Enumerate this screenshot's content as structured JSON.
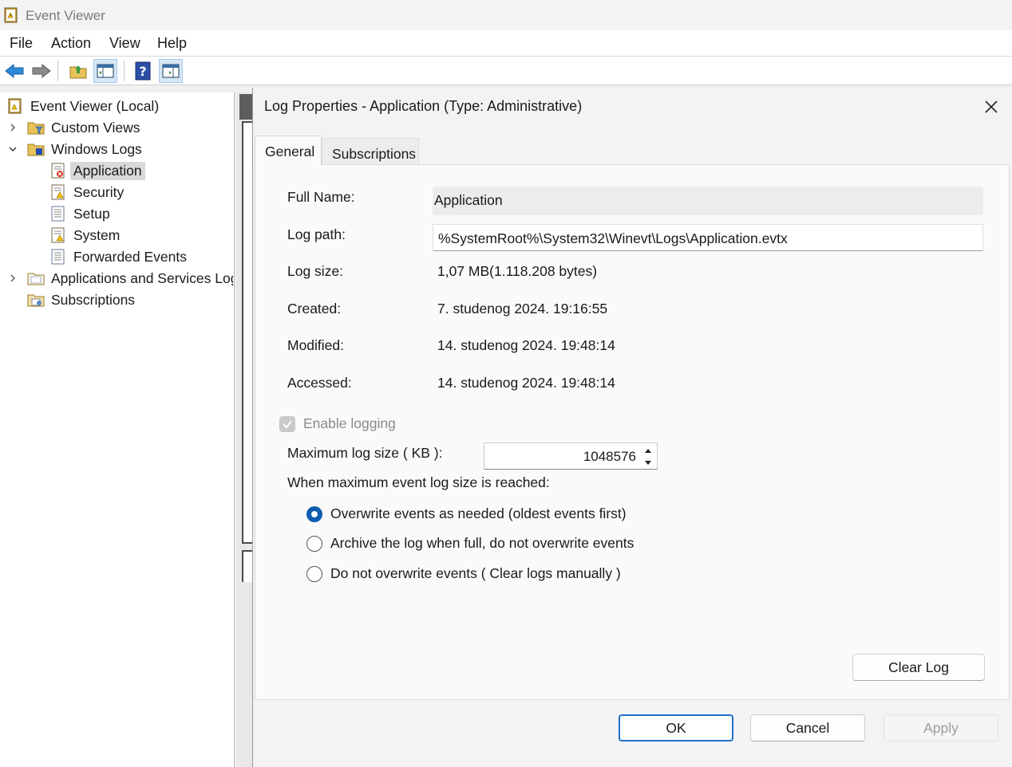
{
  "window": {
    "title": "Event Viewer"
  },
  "menu": {
    "items": [
      "File",
      "Action",
      "View",
      "Help"
    ]
  },
  "toolbar": {
    "icons": [
      "back-arrow-icon",
      "forward-arrow-icon",
      "up-folder-icon",
      "show-hide-tree-icon",
      "help-icon",
      "show-hide-action-pane-icon"
    ]
  },
  "tree": {
    "root": "Event Viewer (Local)",
    "custom_views": "Custom Views",
    "windows_logs": "Windows Logs",
    "application": "Application",
    "security": "Security",
    "setup": "Setup",
    "system": "System",
    "forwarded_events": "Forwarded Events",
    "apps_services": "Applications and Services Logs",
    "subscriptions": "Subscriptions"
  },
  "dialog": {
    "title": "Log Properties - Application (Type: Administrative)",
    "tabs": [
      "General",
      "Subscriptions"
    ],
    "labels": {
      "full_name": "Full Name:",
      "log_path": "Log path:",
      "log_size": "Log size:",
      "created": "Created:",
      "modified": "Modified:",
      "accessed": "Accessed:"
    },
    "values": {
      "full_name": "Application",
      "log_path": "%SystemRoot%\\System32\\Winevt\\Logs\\Application.evtx",
      "log_size": "1,07 MB(1.118.208 bytes)",
      "created": "7. studenog 2024. 19:16:55",
      "modified": "14. studenog 2024. 19:48:14",
      "accessed": "14. studenog 2024. 19:48:14"
    },
    "enable_logging": {
      "label": "Enable logging",
      "checked": true
    },
    "max_size": {
      "label": "Maximum log size ( KB ):",
      "value": "1048576"
    },
    "when_max": "When maximum event log size is reached:",
    "radios": [
      {
        "label": "Overwrite events as needed (oldest events first)",
        "selected": true
      },
      {
        "label": "Archive the log when full, do not overwrite events",
        "selected": false
      },
      {
        "label": "Do not overwrite events ( Clear logs manually )",
        "selected": false
      }
    ],
    "buttons": {
      "clear_log": "Clear Log",
      "ok": "OK",
      "cancel": "Cancel",
      "apply": "Apply"
    }
  },
  "colors": {
    "accent": "#0b5cad",
    "selection": "#d9d9d9"
  }
}
